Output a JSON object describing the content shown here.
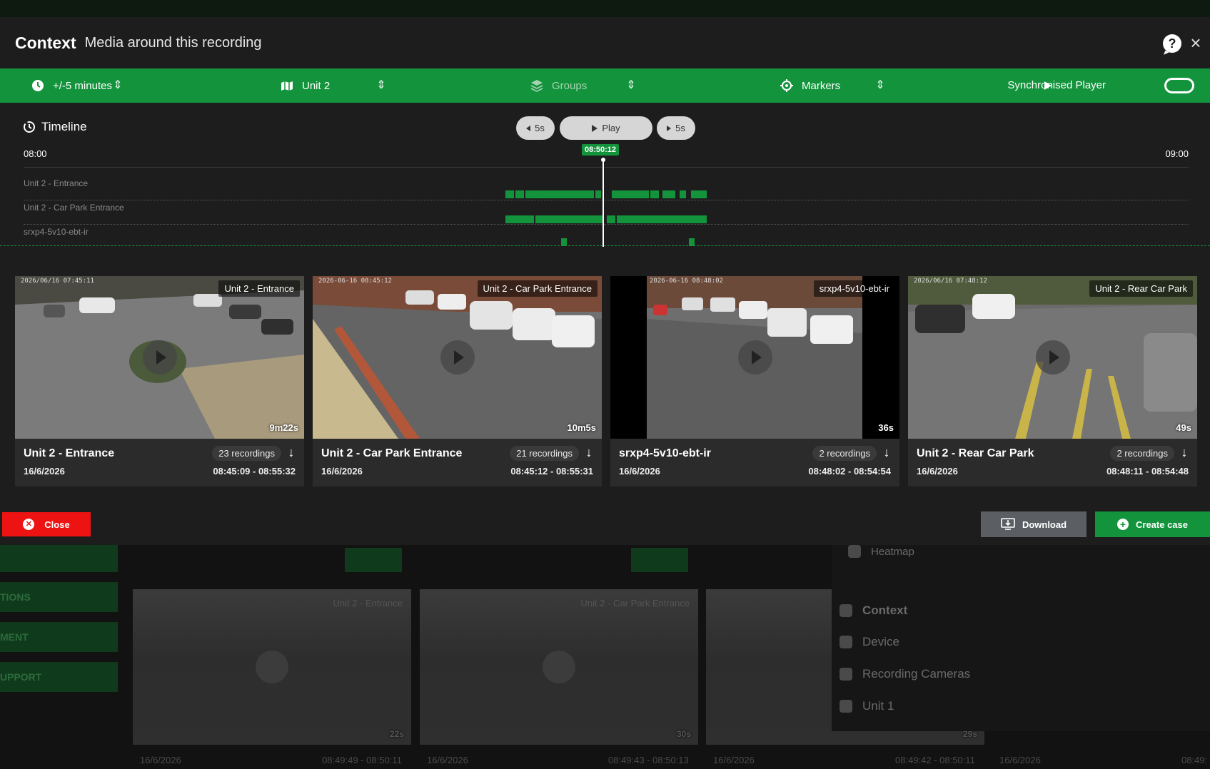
{
  "background": {
    "sidebar_buttons": [
      "",
      "TIONS",
      "MENT",
      "UPPORT"
    ],
    "cards": [
      {
        "label": "Unit 2 - Entrance",
        "duration": "22s",
        "date": "16/6/2026",
        "time": "08:49:49 - 08:50:11"
      },
      {
        "label": "Unit 2 - Car Park Entrance",
        "duration": "30s",
        "date": "16/6/2026",
        "time": "08:49:43 - 08:50:13"
      },
      {
        "label": "",
        "duration": "29s",
        "date": "16/6/2026",
        "time": "08:49:42 - 08:50:11"
      }
    ],
    "extra_date": "16/6/2026",
    "extra_time": "08:49:",
    "panel": {
      "heatmap": "Heatmap",
      "items": [
        "Context",
        "Device",
        "Recording Cameras",
        "Unit 1"
      ]
    }
  },
  "header": {
    "title": "Context",
    "subtitle": "Media around this recording"
  },
  "toolbar": {
    "time_range": "+/-5 minutes",
    "unit": "Unit 2",
    "groups": "Groups",
    "markers": "Markers",
    "sync_player": "Synchronised Player",
    "sync_enabled": true
  },
  "timeline": {
    "title": "Timeline",
    "back_label": "5s",
    "play_label": "Play",
    "forward_label": "5s",
    "start": "08:00",
    "end": "09:00",
    "current": "08:50:12",
    "tracks": [
      {
        "label": "Unit 2 - Entrance"
      },
      {
        "label": "Unit 2 - Car Park Entrance"
      },
      {
        "label": "srxp4-5v10-ebt-ir"
      }
    ]
  },
  "cards": [
    {
      "cam_label": "Unit 2 - Entrance",
      "timestamp": "2026/06/16 07:45:11",
      "duration": "9m22s",
      "name": "Unit 2 - Entrance",
      "recordings": "23 recordings",
      "date": "16/6/2026",
      "time": "08:45:09 - 08:55:32"
    },
    {
      "cam_label": "Unit 2 - Car Park Entrance",
      "timestamp": "2026-06-16 08:45:12",
      "duration": "10m5s",
      "name": "Unit 2 - Car Park Entrance",
      "recordings": "21 recordings",
      "date": "16/6/2026",
      "time": "08:45:12 - 08:55:31"
    },
    {
      "cam_label": "srxp4-5v10-ebt-ir",
      "timestamp": "2026-06-16 08:48:02",
      "duration": "36s",
      "name": "srxp4-5v10-ebt-ir",
      "recordings": "2 recordings",
      "date": "16/6/2026",
      "time": "08:48:02 - 08:54:54"
    },
    {
      "cam_label": "Unit 2 - Rear Car Park",
      "timestamp": "2026/06/16 07:48:12",
      "duration": "49s",
      "name": "Unit 2 - Rear Car Park",
      "recordings": "2 recordings",
      "date": "16/6/2026",
      "time": "08:48:11 - 08:54:48"
    }
  ],
  "footer": {
    "close_label": "Close",
    "download_label": "Download",
    "create_case_label": "Create case"
  },
  "colors": {
    "accent": "#13943c",
    "danger": "#ee1313",
    "neutral_button": "#5b5f64",
    "modal_bg": "#1d1d1d"
  }
}
